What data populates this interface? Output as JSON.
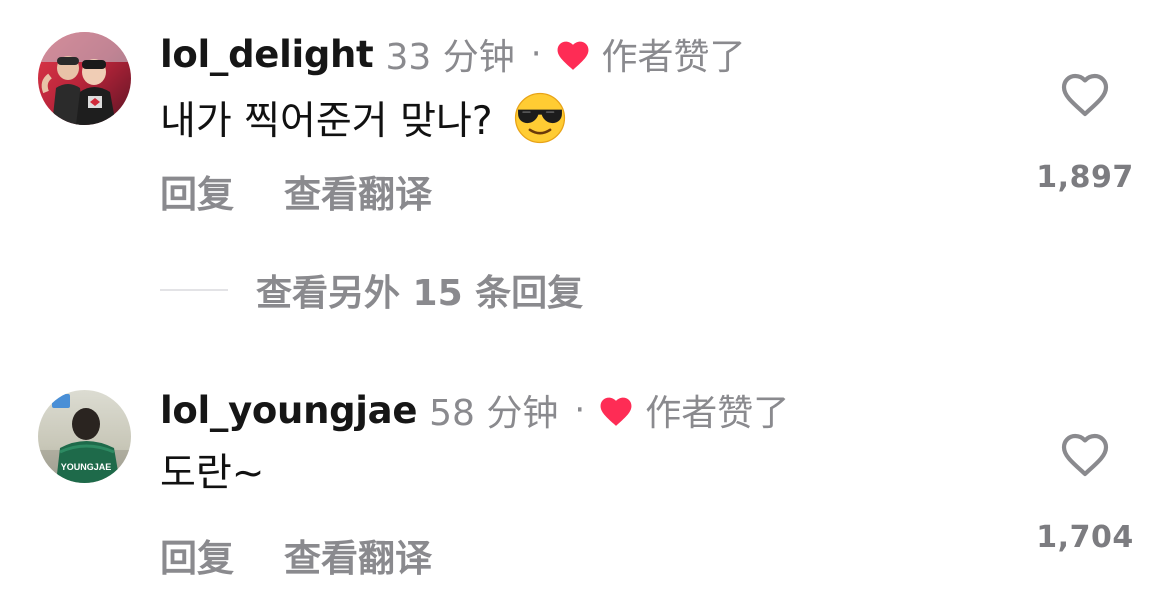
{
  "comments": [
    {
      "username": "lol_delight",
      "time": "33 分钟",
      "separator": "·",
      "liked_by_author": "作者赞了",
      "text": "내가 찍어준거 맞나?",
      "emoji": "smiling-face-with-sunglasses",
      "reply_label": "回复",
      "translate_label": "查看翻译",
      "like_count": "1,897"
    },
    {
      "username": "lol_youngjae",
      "time": "58 分钟",
      "separator": "·",
      "liked_by_author": "作者赞了",
      "text": "도란~",
      "reply_label": "回复",
      "translate_label": "查看翻译",
      "like_count": "1,704",
      "avatar_jersey_text": "YOUNGJAE"
    }
  ],
  "view_more_replies": "查看另外 15 条回复",
  "colors": {
    "author_heart": "#fe2c55",
    "secondary_text": "#8a8a8e",
    "primary_text": "#111111"
  }
}
